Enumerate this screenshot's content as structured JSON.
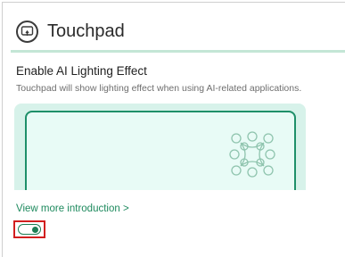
{
  "header": {
    "title": "Touchpad",
    "icon": "touchpad-icon"
  },
  "feature": {
    "title": "Enable AI Lighting Effect",
    "description": "Touchpad will show lighting effect when using AI-related applications.",
    "link_label": "View more introduction >",
    "toggle_state": "on"
  },
  "colors": {
    "accent": "#1e8a5e",
    "divider": "#c4e6d6",
    "preview_bg": "#d7f2ea",
    "highlight": "#d21f1f"
  }
}
